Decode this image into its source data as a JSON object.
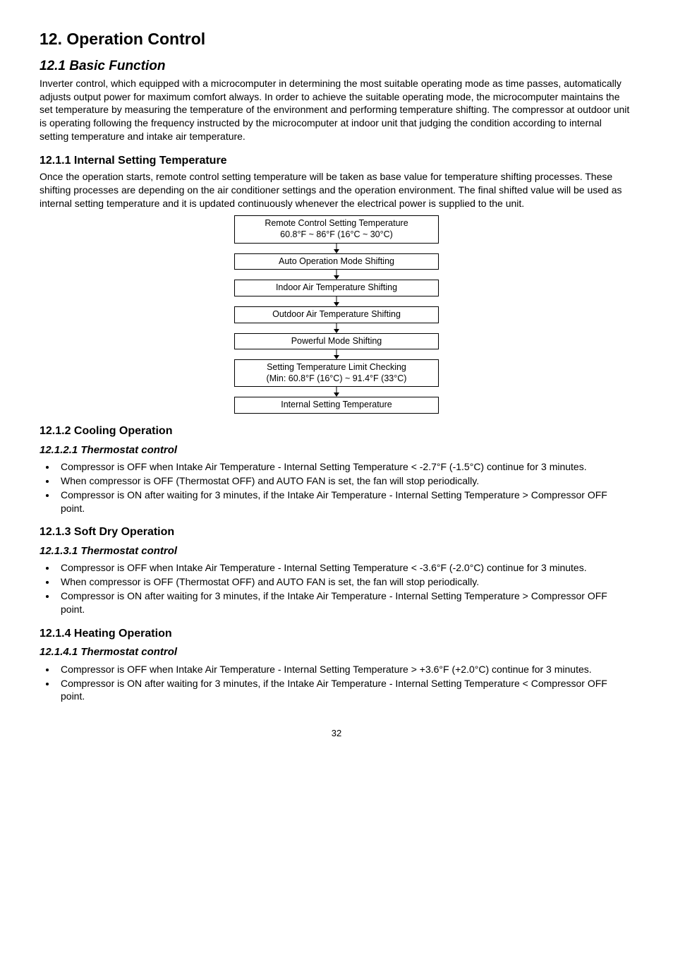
{
  "headings": {
    "h1": "12.   Operation Control",
    "h2": "12.1  Basic Function",
    "h3_1": "12.1.1    Internal Setting Temperature",
    "h3_2": "12.1.2    Cooling Operation",
    "h4_2": "12.1.2.1    Thermostat control",
    "h3_3": "12.1.3    Soft Dry Operation",
    "h4_3": "12.1.3.1    Thermostat control",
    "h3_4": "12.1.4    Heating Operation",
    "h4_4": "12.1.4.1    Thermostat control"
  },
  "paragraphs": {
    "p1": "Inverter control, which equipped with a microcomputer in determining the most suitable operating mode as time passes, automatically adjusts output power for maximum comfort always. In order to achieve the suitable operating mode, the microcomputer maintains the set temperature by measuring the temperature of the environment and performing temperature shifting. The compressor at outdoor unit is operating following the frequency instructed by the microcomputer at indoor unit that judging the condition according to internal setting temperature and intake air temperature.",
    "p2": "Once the operation starts, remote control setting temperature will be taken as base value for temperature shifting processes. These shifting processes are depending on the air conditioner settings and the operation environment. The final shifted value will be used as internal setting temperature and it is updated continuously whenever the electrical power is supplied to the unit."
  },
  "flow": {
    "b1a": "Remote Control Setting Temperature",
    "b1b": "60.8°F ~ 86°F (16°C ~ 30°C)",
    "b2": "Auto Operation Mode Shifting",
    "b3": "Indoor Air Temperature Shifting",
    "b4": "Outdoor Air Temperature Shifting",
    "b5": "Powerful Mode Shifting",
    "b6a": "Setting Temperature Limit Checking",
    "b6b": "(Min: 60.8°F (16°C) ~ 91.4°F (33°C)",
    "b7": "Internal Setting Temperature"
  },
  "bullets": {
    "cooling": [
      "Compressor is OFF when Intake Air Temperature - Internal Setting Temperature < -2.7°F (-1.5°C) continue for 3 minutes.",
      "When compressor is OFF (Thermostat OFF) and AUTO FAN is set, the fan will stop periodically.",
      "Compressor is ON after waiting for 3 minutes, if the Intake Air Temperature - Internal Setting Temperature > Compressor OFF point."
    ],
    "softdry": [
      "Compressor is OFF when Intake Air Temperature - Internal Setting Temperature < -3.6°F (-2.0°C) continue for 3 minutes.",
      "When compressor is OFF (Thermostat OFF) and AUTO FAN is set, the fan will stop periodically.",
      "Compressor is ON after waiting for 3 minutes, if the Intake Air Temperature - Internal Setting Temperature > Compressor OFF point."
    ],
    "heating": [
      "Compressor is OFF when Intake Air Temperature - Internal Setting Temperature > +3.6°F (+2.0°C) continue for 3 minutes.",
      "Compressor is ON after waiting for 3 minutes, if the Intake Air Temperature - Internal Setting Temperature < Compressor OFF point."
    ]
  },
  "pagenum": "32"
}
